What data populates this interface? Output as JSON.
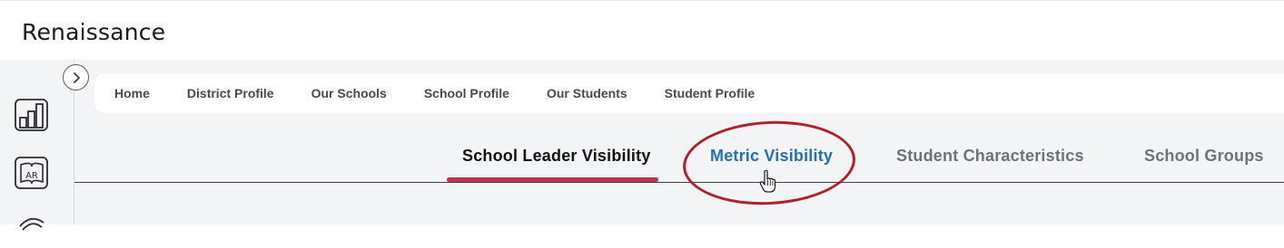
{
  "app": {
    "logo_text": "Renaissance"
  },
  "rail": {
    "expand_icon": "chevron-right-icon",
    "items": [
      {
        "icon": "bar-chart-icon"
      },
      {
        "icon": "ar-book-icon",
        "label": "AR"
      },
      {
        "icon": "link-icon"
      }
    ]
  },
  "nav": {
    "links": [
      {
        "label": "Home"
      },
      {
        "label": "District Profile"
      },
      {
        "label": "Our Schools"
      },
      {
        "label": "School Profile"
      },
      {
        "label": "Our Students"
      },
      {
        "label": "Student Profile"
      }
    ]
  },
  "tabs": [
    {
      "label": "School Leader Visibility",
      "state": "active"
    },
    {
      "label": "Metric Visibility",
      "state": "hover"
    },
    {
      "label": "Student Characteristics",
      "state": "normal"
    },
    {
      "label": "School Groups",
      "state": "normal"
    }
  ],
  "colors": {
    "active_underline": "#c0334a",
    "hover_tab": "#2670ad",
    "annotation_circle": "#b2202e",
    "background": "#f3f4f6"
  }
}
